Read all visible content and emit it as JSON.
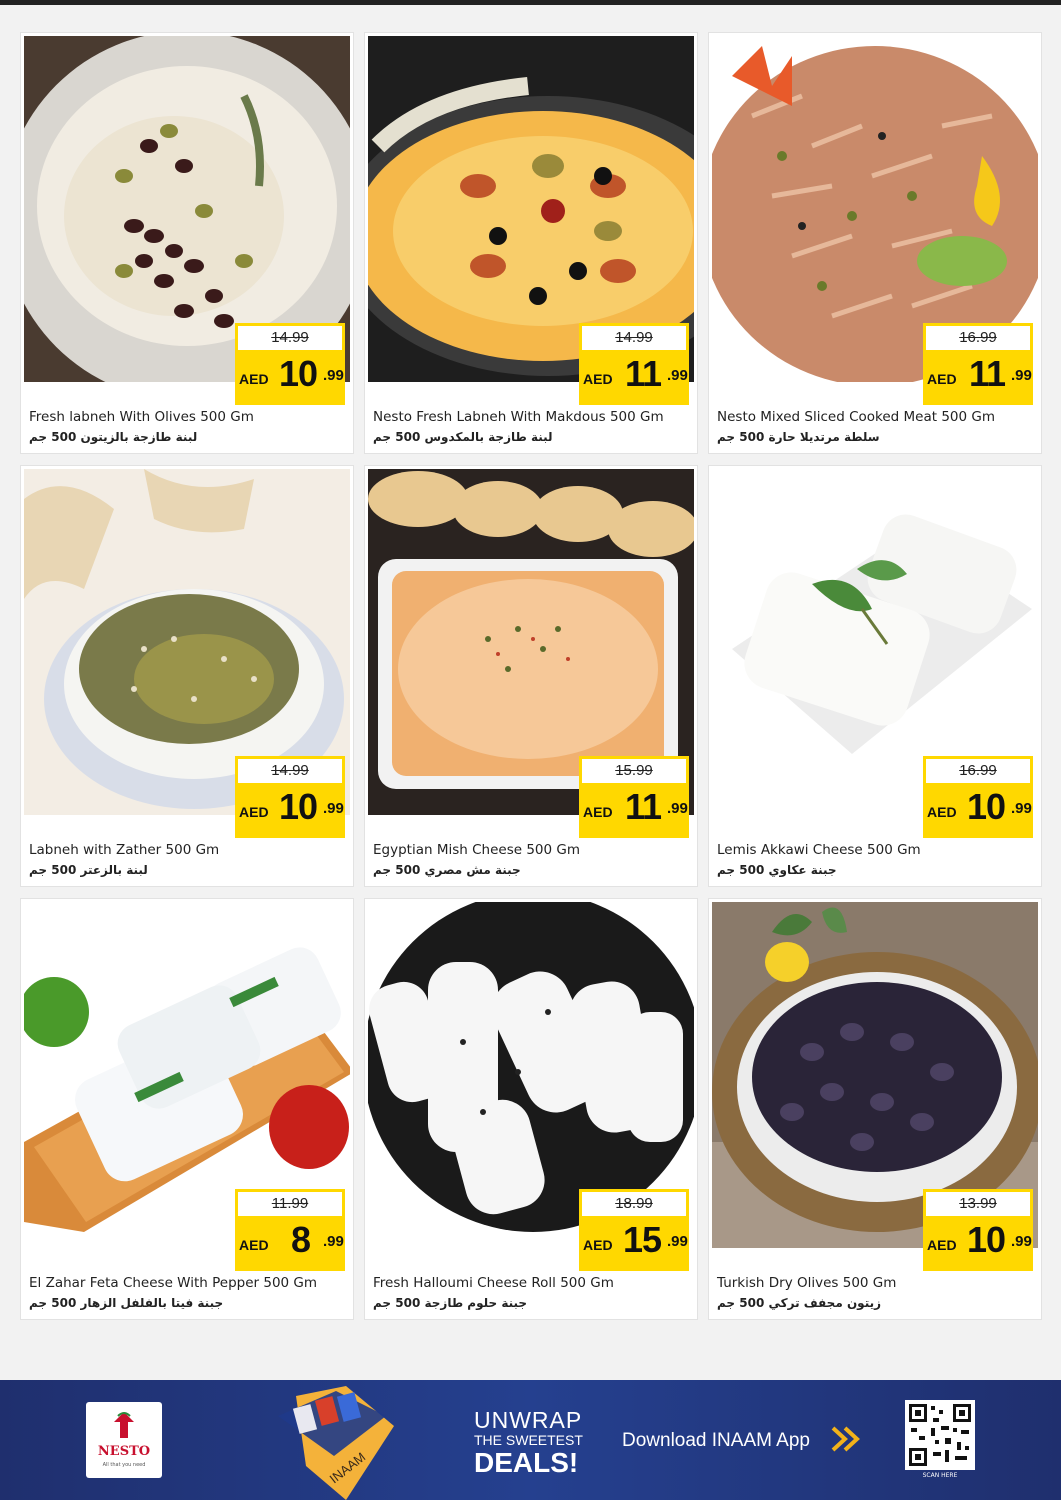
{
  "currency": "AED",
  "products": [
    {
      "name_en": "Fresh labneh With Olives 500 Gm",
      "name_ar": "لبنة طازجة بالزيتون 500 جم",
      "old_price": "14.99",
      "price_int": "10",
      "price_dec": ".99",
      "image": "labneh-olives-plate"
    },
    {
      "name_en": "Nesto Fresh Labneh With Makdous 500 Gm",
      "name_ar": "لبنة طازجة بالمكدوس 500 جم",
      "old_price": "14.99",
      "price_int": "11",
      "price_dec": ".99",
      "image": "labneh-makdous-dish"
    },
    {
      "name_en": "Nesto Mixed Sliced Cooked Meat 500 Gm",
      "name_ar": "سلطة مرتديلا حارة 500 جم",
      "old_price": "16.99",
      "price_int": "11",
      "price_dec": ".99",
      "image": "sliced-meat-salad"
    },
    {
      "name_en": "Labneh with Zather 500 Gm",
      "name_ar": "لبنة بالزعتر 500 جم",
      "old_price": "14.99",
      "price_int": "10",
      "price_dec": ".99",
      "image": "labneh-zaatar-bowl"
    },
    {
      "name_en": "Egyptian Mish Cheese 500 Gm",
      "name_ar": "جبنة مش مصري 500 جم",
      "old_price": "15.99",
      "price_int": "11",
      "price_dec": ".99",
      "image": "mish-cheese-tray"
    },
    {
      "name_en": "Lemis Akkawi Cheese 500 Gm",
      "name_ar": "جبنة عكاوي 500 جم",
      "old_price": "16.99",
      "price_int": "10",
      "price_dec": ".99",
      "image": "akkawi-cheese-blocks"
    },
    {
      "name_en": "El Zahar Feta Cheese With Pepper 500 Gm",
      "name_ar": "جبنة فيتا بالفلفل الزهار 500 جم",
      "old_price": "11.99",
      "price_int": "8",
      "price_dec": ".99",
      "image": "feta-cheese-board"
    },
    {
      "name_en": "Fresh Halloumi Cheese Roll 500 Gm",
      "name_ar": "جبنة حلوم طازجة 500 جم",
      "old_price": "18.99",
      "price_int": "15",
      "price_dec": ".99",
      "image": "halloumi-rolls"
    },
    {
      "name_en": "Turkish Dry Olives 500 Gm",
      "name_ar": "زيتون مجفف تركي 500 جم",
      "old_price": "13.99",
      "price_int": "10",
      "price_dec": ".99",
      "image": "dry-olives-basket"
    }
  ],
  "footer": {
    "brand": "NESTO",
    "brand_tagline": "All that you need",
    "pack_label": "INAAM",
    "unwrap_line1": "UNWRAP",
    "unwrap_line2": "THE SWEETEST",
    "unwrap_line3": "DEALS!",
    "download_text": "Download INAAM App",
    "scan_text": "SCAN HERE"
  },
  "colors": {
    "price_bg": "#ffd800",
    "footer_bg": "#25408f",
    "brand_red": "#c8102e"
  }
}
